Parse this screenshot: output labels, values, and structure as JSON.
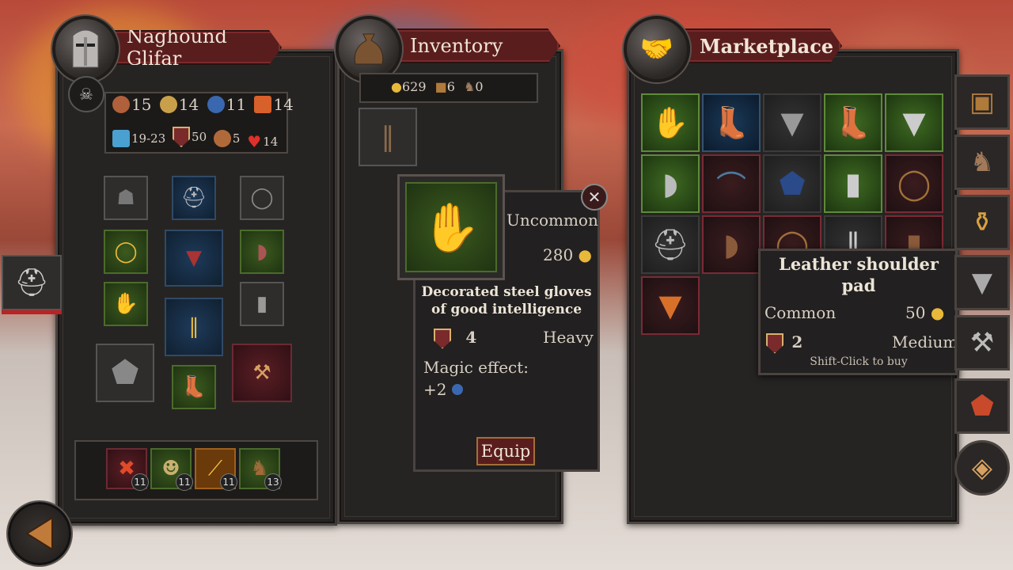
{
  "character": {
    "name": "Naghound Glifar",
    "stats_row1": [
      {
        "icon": "strength-icon",
        "value": "15"
      },
      {
        "icon": "agility-icon",
        "value": "14"
      },
      {
        "icon": "intelligence-icon",
        "value": "11"
      },
      {
        "icon": "health-icon",
        "value": "14"
      }
    ],
    "stats_row2": [
      {
        "icon": "damage-icon",
        "value": "19-23"
      },
      {
        "icon": "armor-icon",
        "value": "50"
      },
      {
        "icon": "speed-icon",
        "value": "5"
      },
      {
        "icon": "heart-icon",
        "value": "14"
      }
    ],
    "skills": [
      {
        "icon": "berserk-skill-icon",
        "level": "11"
      },
      {
        "icon": "archer-skill-icon",
        "level": "11"
      },
      {
        "icon": "sword-skill-icon",
        "level": "11"
      },
      {
        "icon": "horse-skill-icon",
        "level": "13"
      }
    ]
  },
  "inventory": {
    "title": "Inventory",
    "gold": "629",
    "food": "6",
    "horses": "0"
  },
  "tooltip_item": {
    "rarity": "Uncommon",
    "price": "280",
    "name_line1": "Decorated steel gloves",
    "name_line2": "of good intelligence",
    "armor": "4",
    "weight": "Heavy",
    "magic_label": "Magic effect:",
    "magic_value": "+2",
    "equip_label": "Equip"
  },
  "marketplace": {
    "title": "Marketplace",
    "hover_name_line1": "Leather shoulder",
    "hover_name_line2": "pad",
    "hover_rarity": "Common",
    "hover_price": "50",
    "hover_armor": "2",
    "hover_weight": "Medium",
    "hover_hint": "Shift-Click to buy"
  },
  "colors": {
    "gold": "#e8b83a",
    "ribbon": "#5a1d1d",
    "uncommon": "#3f6a22",
    "rare": "#34526e",
    "junk": "#7a2a35"
  }
}
